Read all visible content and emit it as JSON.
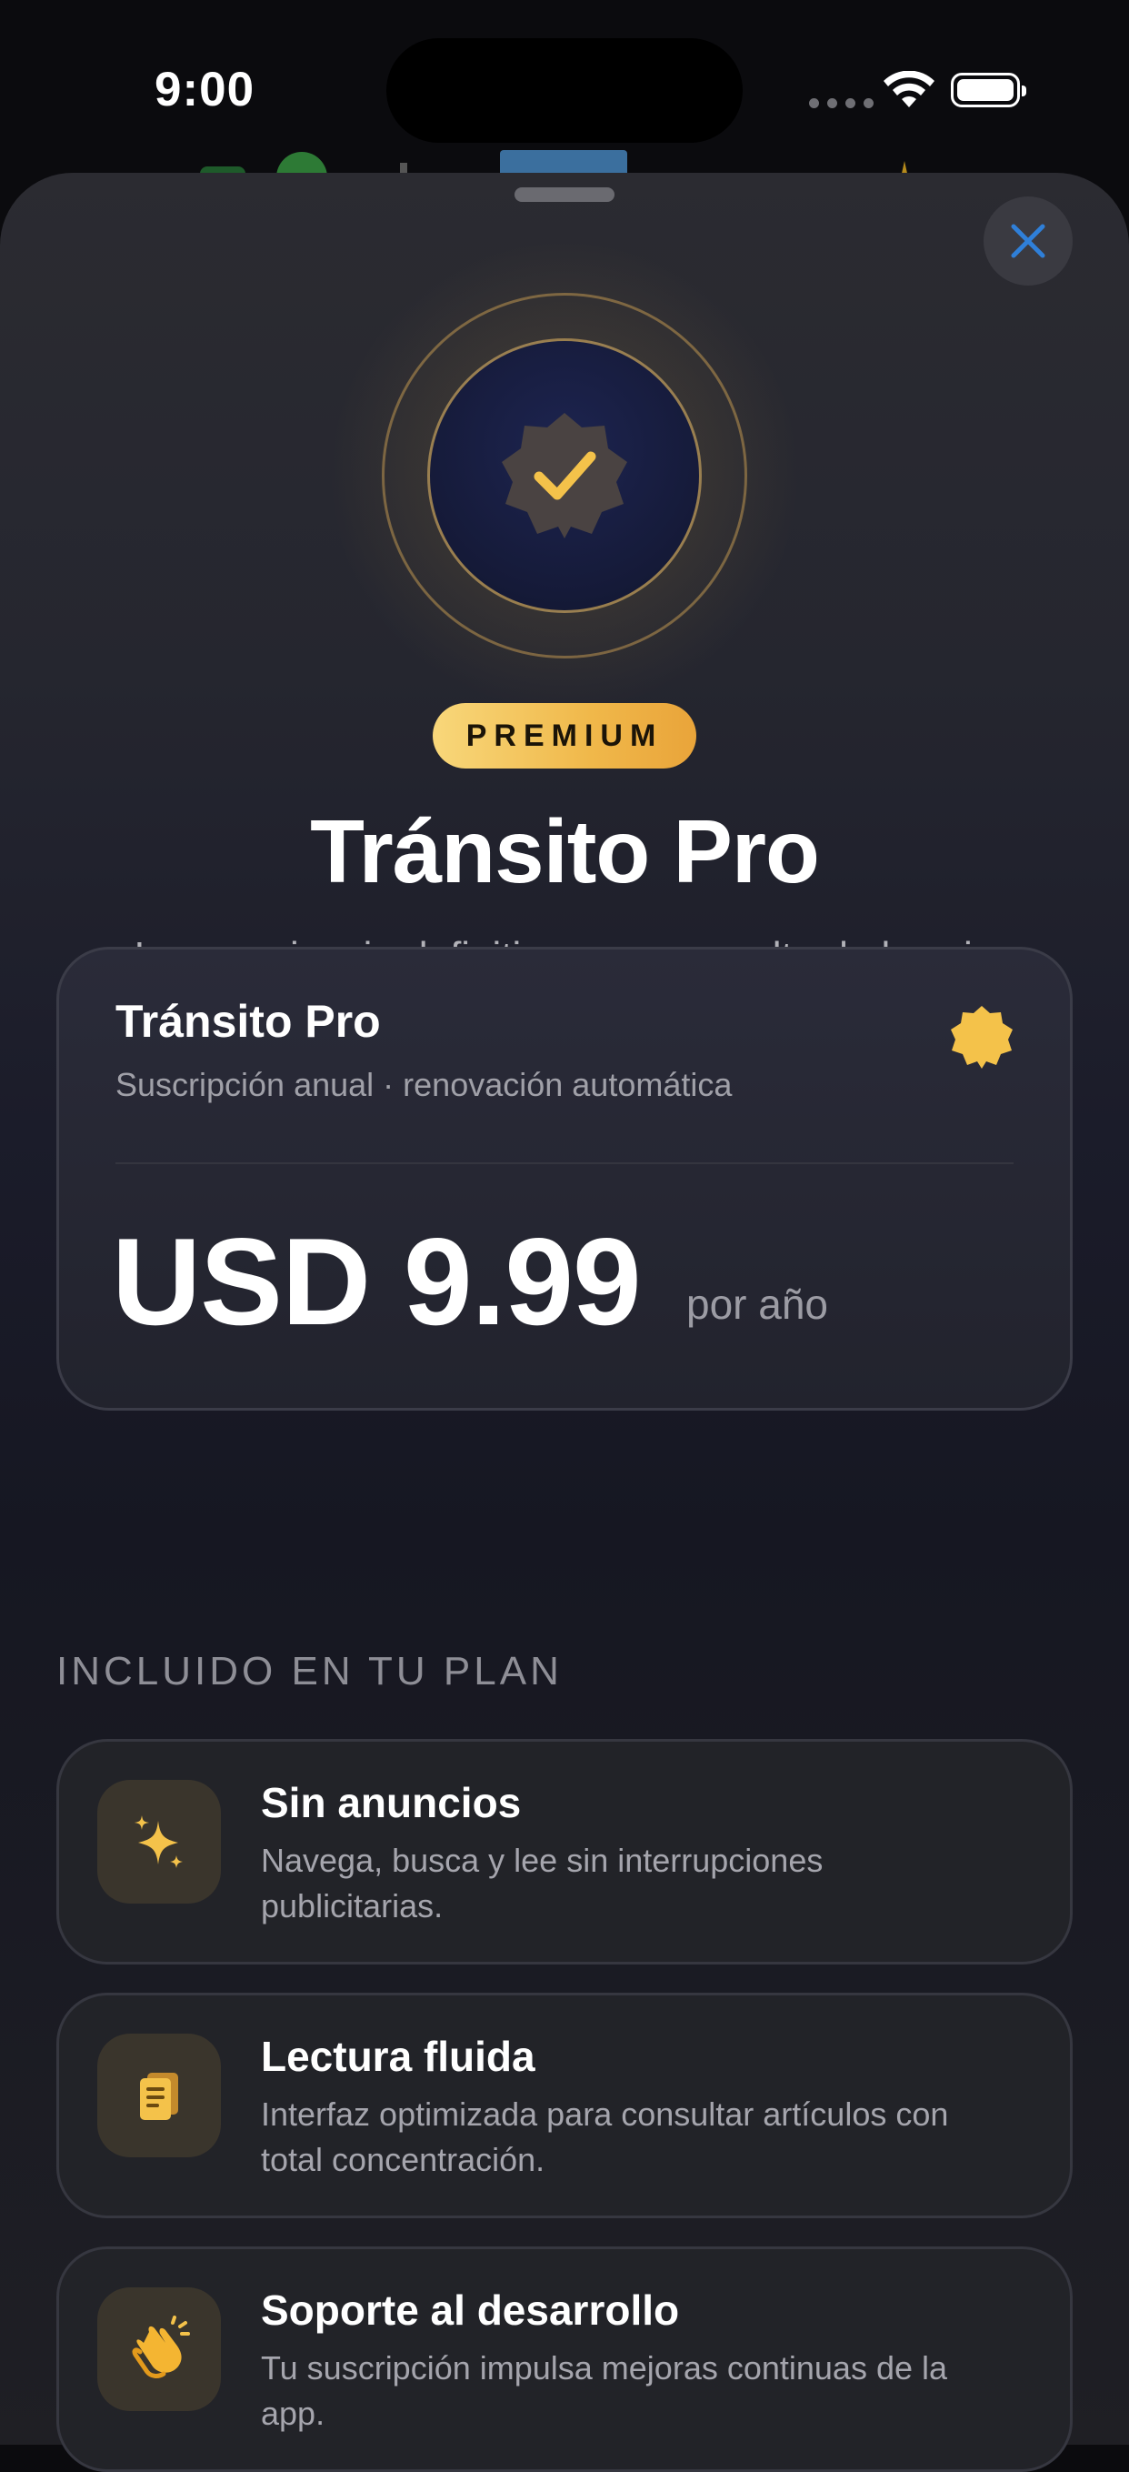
{
  "status_bar": {
    "time": "9:00"
  },
  "sheet": {
    "premium_label": "PREMIUM",
    "title": "Tránsito Pro",
    "subtitle": "La experiencia definitiva para consultar la ley sin interrupciones."
  },
  "plan_card": {
    "name": "Tránsito Pro",
    "description": "Suscripción anual · renovación automática",
    "price": "USD 9.99",
    "period": "por año"
  },
  "included": {
    "section_label": "INCLUIDO EN TU PLAN",
    "features": [
      {
        "title": "Sin anuncios",
        "description": "Navega, busca y lee sin interrupciones publicitarias.",
        "icon": "sparkles-icon"
      },
      {
        "title": "Lectura fluida",
        "description": "Interfaz optimizada para consultar artículos con total concentración.",
        "icon": "document-icon"
      },
      {
        "title": "Soporte al desarrollo",
        "description": "Tu suscripción impulsa mejoras continuas de la app.",
        "icon": "clapping-hands-icon"
      }
    ]
  },
  "colors": {
    "accent_gold": "#f0b84a",
    "close_icon": "#2f7fd8",
    "sheet_background": "#25262f"
  }
}
